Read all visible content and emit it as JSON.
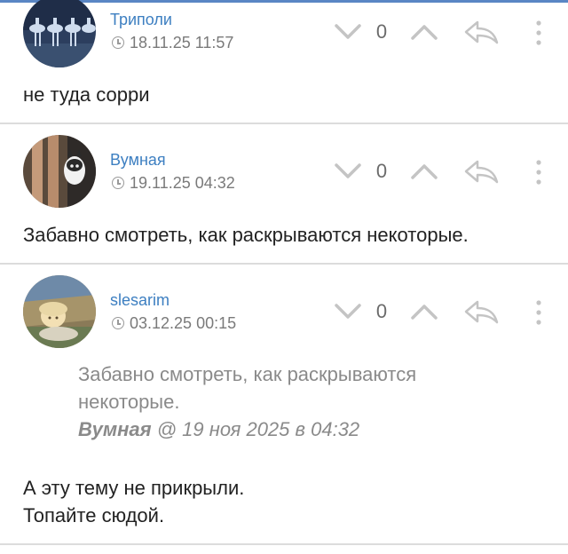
{
  "comments": [
    {
      "author": "Триполи",
      "datetime": "18.11.25 11:57",
      "score": "0",
      "text": "не туда сорри",
      "avatar_icon": "ballet-dancers-avatar"
    },
    {
      "author": "Вумная",
      "datetime": "19.11.25 04:32",
      "score": "0",
      "text": "Забавно смотреть, как раскрываются некоторые.",
      "avatar_icon": "legs-with-husky-avatar"
    },
    {
      "author": "slesarim",
      "datetime": "03.12.25 00:15",
      "score": "0",
      "quote": {
        "text": "Забавно смотреть, как раскрываются некоторые.",
        "cite_author": "Вумная",
        "cite_rest": " @ 19 ноя 2025 в 04:32"
      },
      "text_lines": [
        "А эту тему не прикрыли.",
        "Топайте сюдой."
      ],
      "avatar_icon": "baby-under-blanket-avatar"
    }
  ],
  "colors": {
    "author": "#3d7fc1",
    "meta": "#7a7a7a",
    "icons": "#c4c4c4",
    "divider": "#dcdcdc",
    "quote": "#8a8a8a"
  },
  "icons": [
    "clock-icon",
    "chevron-down-icon",
    "chevron-up-icon",
    "reply-arrow-icon",
    "more-vertical-icon"
  ]
}
